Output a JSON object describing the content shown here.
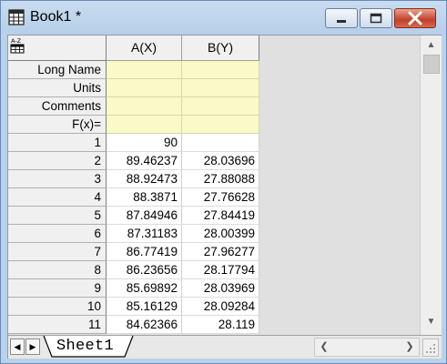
{
  "window": {
    "title": "Book1 *",
    "app_icon": "spreadsheet-icon",
    "minimize_icon": "minimize-icon",
    "maximize_icon": "maximize-icon",
    "close_icon": "close-icon"
  },
  "grid": {
    "corner_icon": "sort-az-icon",
    "columns": [
      "A(X)",
      "B(Y)"
    ],
    "meta_rows": [
      "Long Name",
      "Units",
      "Comments",
      "F(x)="
    ],
    "rows": [
      {
        "num": "1",
        "a": "90",
        "b": ""
      },
      {
        "num": "2",
        "a": "89.46237",
        "b": "28.03696"
      },
      {
        "num": "3",
        "a": "88.92473",
        "b": "27.88088"
      },
      {
        "num": "4",
        "a": "88.3871",
        "b": "27.76628"
      },
      {
        "num": "5",
        "a": "87.84946",
        "b": "27.84419"
      },
      {
        "num": "6",
        "a": "87.31183",
        "b": "28.00399"
      },
      {
        "num": "7",
        "a": "86.77419",
        "b": "27.96277"
      },
      {
        "num": "8",
        "a": "86.23656",
        "b": "28.17794"
      },
      {
        "num": "9",
        "a": "85.69892",
        "b": "28.03969"
      },
      {
        "num": "10",
        "a": "85.16129",
        "b": "28.09284"
      },
      {
        "num": "11",
        "a": "84.62366",
        "b": "28.119"
      }
    ]
  },
  "sheets": {
    "tabs": [
      "Sheet1"
    ]
  },
  "colors": {
    "meta_background": "#fafac8",
    "close_button": "#c1412b",
    "title_bar": "#c9dcf0"
  }
}
